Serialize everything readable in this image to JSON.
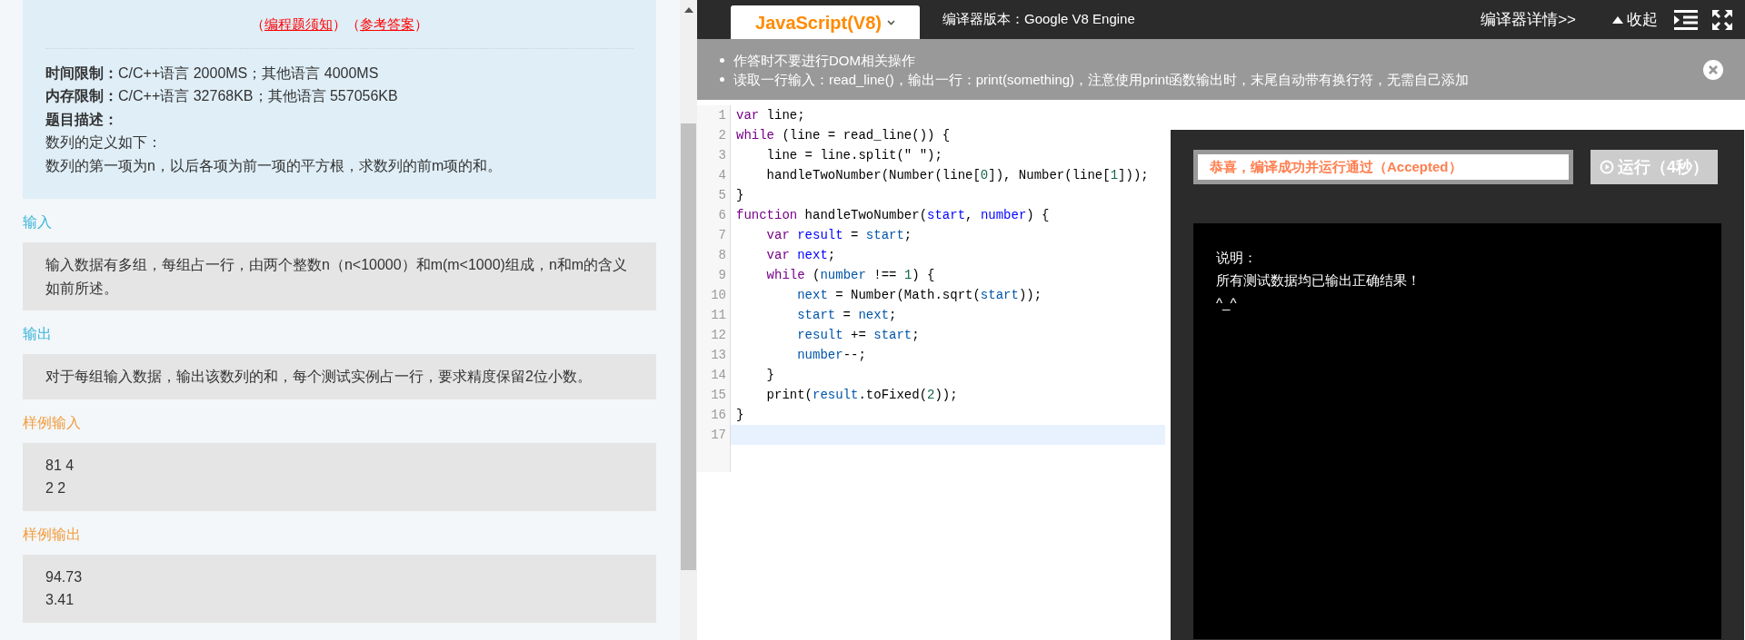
{
  "problem": {
    "links": [
      {
        "prefix": "（",
        "text": "编程题须知",
        "suffix": "）"
      },
      {
        "prefix": "（",
        "text": "参考答案",
        "suffix": "）"
      }
    ],
    "info_lines": [
      "**时间限制：**C/C++语言 2000MS；其他语言 4000MS",
      "**内存限制：**C/C++语言 32768KB；其他语言 557056KB"
    ],
    "description_label": "题目描述：",
    "description": [
      "数列的定义如下：",
      "数列的第一项为n，以后各项为前一项的平方根，求数列的前m项的和。"
    ]
  },
  "sections": [
    {
      "kind": "spec",
      "heading": "输入",
      "lines": [
        "输入数据有多组，每组占一行，由两个整数n（n<10000）和m(m<1000)组成，n和m的含义如前所述。"
      ]
    },
    {
      "kind": "spec",
      "heading": "输出",
      "lines": [
        "对于每组输入数据，输出该数列的和，每个测试实例占一行，要求精度保留2位小数。"
      ]
    },
    {
      "kind": "sample",
      "heading": "样例输入",
      "lines": [
        "81 4",
        "2 2"
      ]
    },
    {
      "kind": "sample",
      "heading": "样例输出",
      "lines": [
        "94.73",
        "3.41"
      ]
    }
  ],
  "toolbar": {
    "language": "JavaScript(V8)",
    "compiler_version": "编译器版本：Google V8 Engine",
    "details_link": "编译器详情>>",
    "collapse": "收起"
  },
  "notices": [
    "作答时不要进行DOM相关操作",
    "读取一行输入：read_line()，输出一行：print(something)，注意使用print函数输出时，末尾自动带有换行符，无需自己添加"
  ],
  "code_lines": [
    {
      "number": "1",
      "active": false,
      "tokens": [
        {
          "kind": "keyword",
          "t": "var"
        },
        {
          "kind": "plain",
          "t": " line;"
        }
      ]
    },
    {
      "number": "2",
      "active": false,
      "tokens": [
        {
          "kind": "keyword",
          "t": "while"
        },
        {
          "kind": "plain",
          "t": " (line = read_line()) {"
        }
      ]
    },
    {
      "number": "3",
      "active": false,
      "tokens": [
        {
          "kind": "plain",
          "t": "    line = line.split(\" \");"
        }
      ]
    },
    {
      "number": "4",
      "active": false,
      "tokens": [
        {
          "kind": "plain",
          "t": "    handleTwoNumber(Number(line["
        },
        {
          "kind": "number",
          "t": "0"
        },
        {
          "kind": "plain",
          "t": "]), Number(line["
        },
        {
          "kind": "number",
          "t": "1"
        },
        {
          "kind": "plain",
          "t": "]));"
        }
      ]
    },
    {
      "number": "5",
      "active": false,
      "tokens": [
        {
          "kind": "plain",
          "t": "}"
        }
      ]
    },
    {
      "number": "6",
      "active": false,
      "tokens": [
        {
          "kind": "keyword",
          "t": "function"
        },
        {
          "kind": "plain",
          "t": " handleTwoNumber("
        },
        {
          "kind": "definition",
          "t": "start"
        },
        {
          "kind": "plain",
          "t": ", "
        },
        {
          "kind": "definition",
          "t": "number"
        },
        {
          "kind": "plain",
          "t": ") {"
        }
      ]
    },
    {
      "number": "7",
      "active": false,
      "tokens": [
        {
          "kind": "keyword",
          "t": "    var"
        },
        {
          "kind": "definition",
          "t": " result"
        },
        {
          "kind": "plain",
          "t": " = "
        },
        {
          "kind": "variable",
          "t": "start"
        },
        {
          "kind": "plain",
          "t": ";"
        }
      ]
    },
    {
      "number": "8",
      "active": false,
      "tokens": [
        {
          "kind": "keyword",
          "t": "    var"
        },
        {
          "kind": "definition",
          "t": " next"
        },
        {
          "kind": "plain",
          "t": ";"
        }
      ]
    },
    {
      "number": "9",
      "active": false,
      "tokens": [
        {
          "kind": "keyword",
          "t": "    while"
        },
        {
          "kind": "plain",
          "t": " ("
        },
        {
          "kind": "variable",
          "t": "number"
        },
        {
          "kind": "plain",
          "t": " !== "
        },
        {
          "kind": "number",
          "t": "1"
        },
        {
          "kind": "plain",
          "t": ") {"
        }
      ]
    },
    {
      "number": "10",
      "active": false,
      "tokens": [
        {
          "kind": "variable",
          "t": "        next"
        },
        {
          "kind": "plain",
          "t": " = Number(Math.sqrt("
        },
        {
          "kind": "variable",
          "t": "start"
        },
        {
          "kind": "plain",
          "t": "));"
        }
      ]
    },
    {
      "number": "11",
      "active": false,
      "tokens": [
        {
          "kind": "variable",
          "t": "        start"
        },
        {
          "kind": "plain",
          "t": " = "
        },
        {
          "kind": "variable",
          "t": "next"
        },
        {
          "kind": "plain",
          "t": ";"
        }
      ]
    },
    {
      "number": "12",
      "active": false,
      "tokens": [
        {
          "kind": "variable",
          "t": "        result"
        },
        {
          "kind": "plain",
          "t": " += "
        },
        {
          "kind": "variable",
          "t": "start"
        },
        {
          "kind": "plain",
          "t": ";"
        }
      ]
    },
    {
      "number": "13",
      "active": false,
      "tokens": [
        {
          "kind": "variable",
          "t": "        number"
        },
        {
          "kind": "plain",
          "t": "--;"
        }
      ]
    },
    {
      "number": "14",
      "active": false,
      "tokens": [
        {
          "kind": "plain",
          "t": "    }"
        }
      ]
    },
    {
      "number": "15",
      "active": false,
      "tokens": [
        {
          "kind": "plain",
          "t": "    print("
        },
        {
          "kind": "variable",
          "t": "result"
        },
        {
          "kind": "plain",
          "t": ".toFixed("
        },
        {
          "kind": "number",
          "t": "2"
        },
        {
          "kind": "plain",
          "t": "));"
        }
      ]
    },
    {
      "number": "16",
      "active": false,
      "tokens": [
        {
          "kind": "plain",
          "t": "}"
        }
      ]
    },
    {
      "number": "17",
      "active": true
    }
  ],
  "result": {
    "status": "恭喜，编译成功并运行通过（Accepted）",
    "run_button": "运行（4秒）",
    "output": [
      "说明：",
      "所有测试数据均已输出正确结果！",
      "^_^"
    ]
  }
}
